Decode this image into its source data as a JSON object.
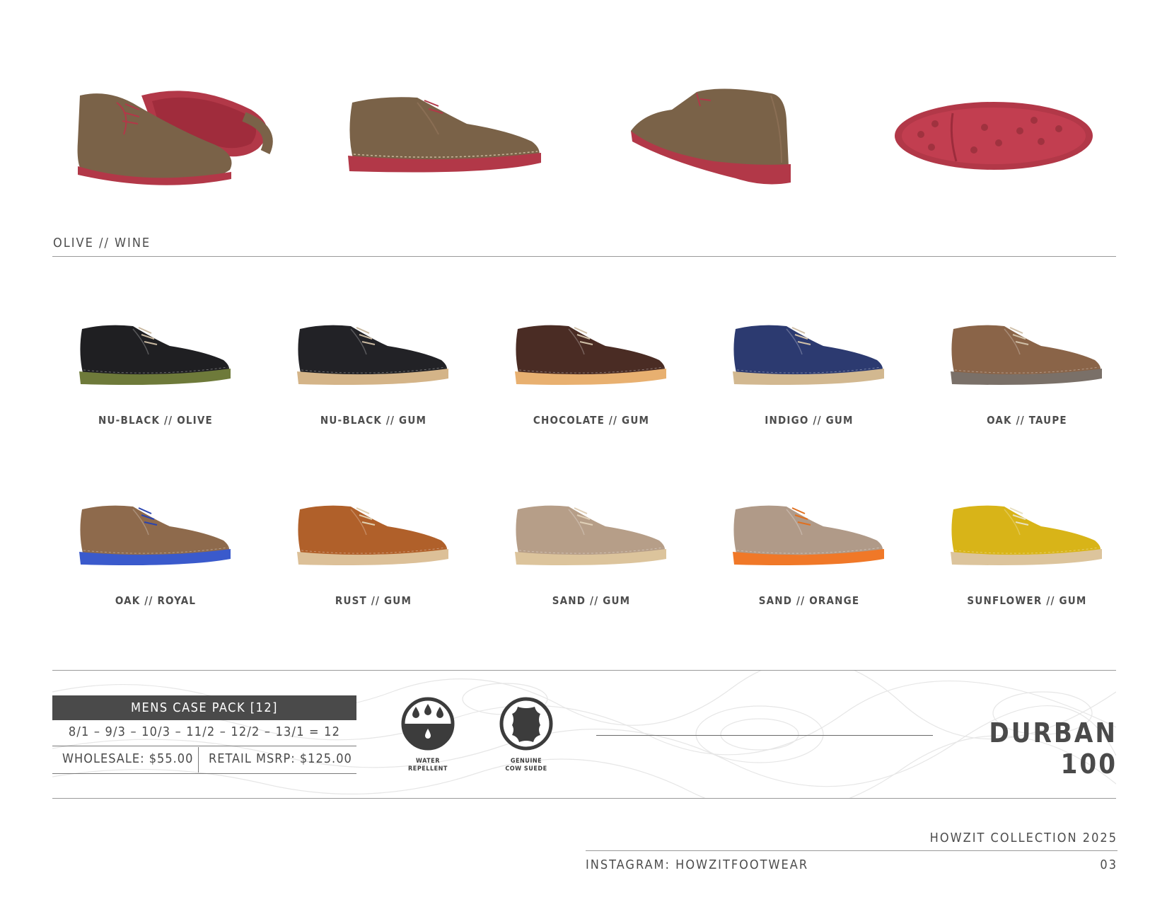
{
  "featured": {
    "colorway": "OLIVE // WINE",
    "views": [
      "pair-view",
      "side-view",
      "rear-view",
      "sole-view"
    ]
  },
  "variants_row1": [
    {
      "name": "NU-BLACK // OLIVE",
      "upper": "#1f1f22",
      "sole": "#6e7a3a",
      "lace": "#c8b8a0"
    },
    {
      "name": "NU-BLACK // GUM",
      "upper": "#222226",
      "sole": "#d4b488",
      "lace": "#c8b8a0"
    },
    {
      "name": "CHOCOLATE // GUM",
      "upper": "#4a2c24",
      "sole": "#e8b070",
      "lace": "#d0c0a8"
    },
    {
      "name": "INDIGO // GUM",
      "upper": "#2c3a70",
      "sole": "#d2b890",
      "lace": "#d0c0a8"
    },
    {
      "name": "OAK // TAUPE",
      "upper": "#8a6448",
      "sole": "#7a7068",
      "lace": "#d0c0a8"
    }
  ],
  "variants_row2": [
    {
      "name": "OAK // ROYAL",
      "upper": "#8e6a4c",
      "sole": "#3a5acc",
      "lace": "#2a44b0"
    },
    {
      "name": "RUST // GUM",
      "upper": "#b0602a",
      "sole": "#dcc098",
      "lace": "#e0d0b0"
    },
    {
      "name": "SAND // GUM",
      "upper": "#b69e88",
      "sole": "#dcc49c",
      "lace": "#e0d0b8"
    },
    {
      "name": "SAND // ORANGE",
      "upper": "#b09a88",
      "sole": "#f07828",
      "lace": "#e07020"
    },
    {
      "name": "SUNFLOWER // GUM",
      "upper": "#d8b418",
      "sole": "#dcc49c",
      "lace": "#e8e0c0"
    }
  ],
  "case_pack": {
    "title": "MENS CASE PACK [12]",
    "sizes": "8/1 – 9/3 – 10/3 – 11/2 – 12/2 – 13/1 = 12",
    "wholesale": "WHOLESALE: $55.00",
    "retail": "RETAIL MSRP: $125.00"
  },
  "badges": [
    {
      "icon": "water-drops-icon",
      "line1": "WATER",
      "line2": "REPELLENT"
    },
    {
      "icon": "leather-hide-icon",
      "line1": "GENUINE",
      "line2": "COW SUEDE"
    }
  ],
  "model_name": "DURBAN 100",
  "footer": {
    "collection": "HOWZIT COLLECTION 2025",
    "instagram": "INSTAGRAM: HOWZITFOOTWEAR",
    "page_number": "03"
  },
  "colors": {
    "text": "#4a4a4a",
    "rule": "#9a9a9a",
    "olive_upper": "#7a6248",
    "wine_sole": "#b23848"
  }
}
